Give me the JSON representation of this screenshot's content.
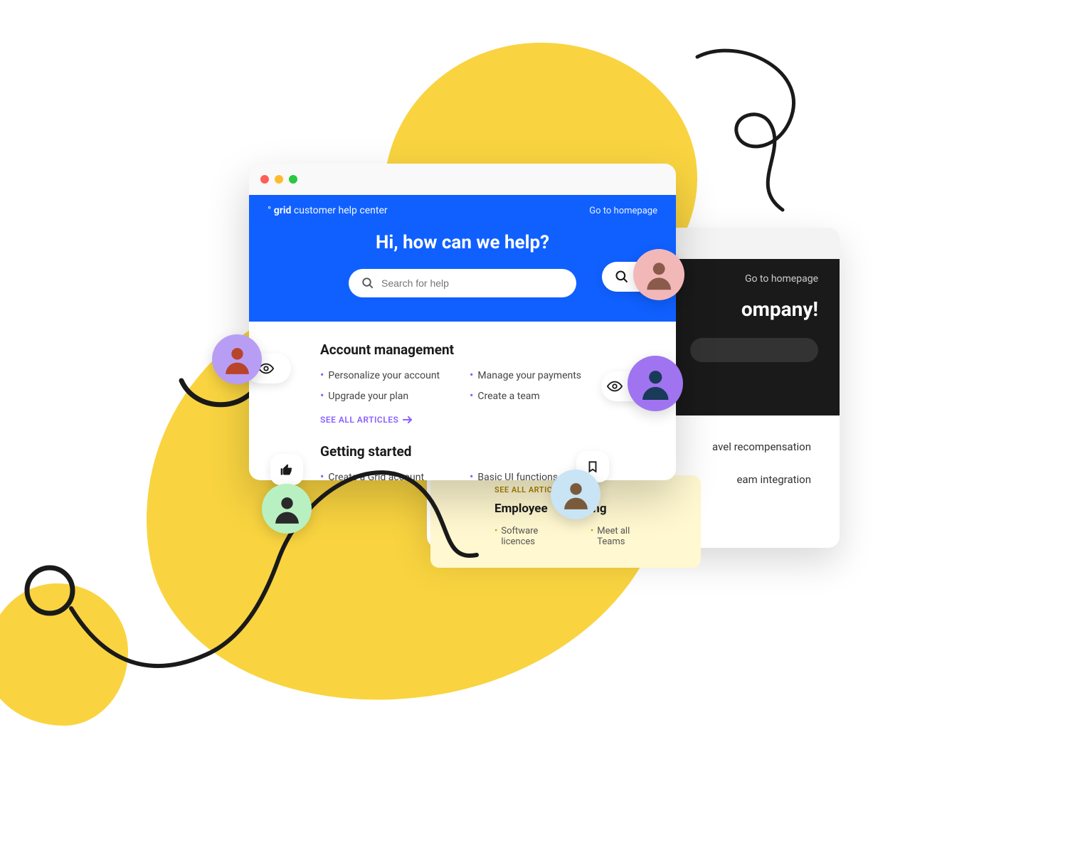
{
  "primary": {
    "logo_prefix": "° ",
    "logo_bold": "grid",
    "logo_suffix": " customer help center",
    "home_link": "Go to homepage",
    "heading": "Hi, how can we help?",
    "search_placeholder": "Search for help",
    "sections": [
      {
        "title": "Account management",
        "items": [
          "Personalize your account",
          "Manage your payments",
          "Upgrade your plan",
          "Create a team"
        ],
        "see_all": "SEE ALL ARTICLES"
      },
      {
        "title": "Getting started",
        "items": [
          "Create a Grid account",
          "Basic UI functions"
        ]
      }
    ]
  },
  "secondary": {
    "home_link": "Go to homepage",
    "heading_fragment": "ompany!",
    "items": [
      "avel recompensation",
      "eam integration"
    ]
  },
  "tertiary": {
    "see_all": "SEE ALL ARTICLE",
    "title_prefix": "Employee",
    "title_suffix": "ing",
    "items": [
      "Software licences",
      "Meet all Teams"
    ]
  },
  "colors": {
    "blue": "#1060ff",
    "yellow": "#f9d440",
    "purple": "#8a5fff"
  }
}
